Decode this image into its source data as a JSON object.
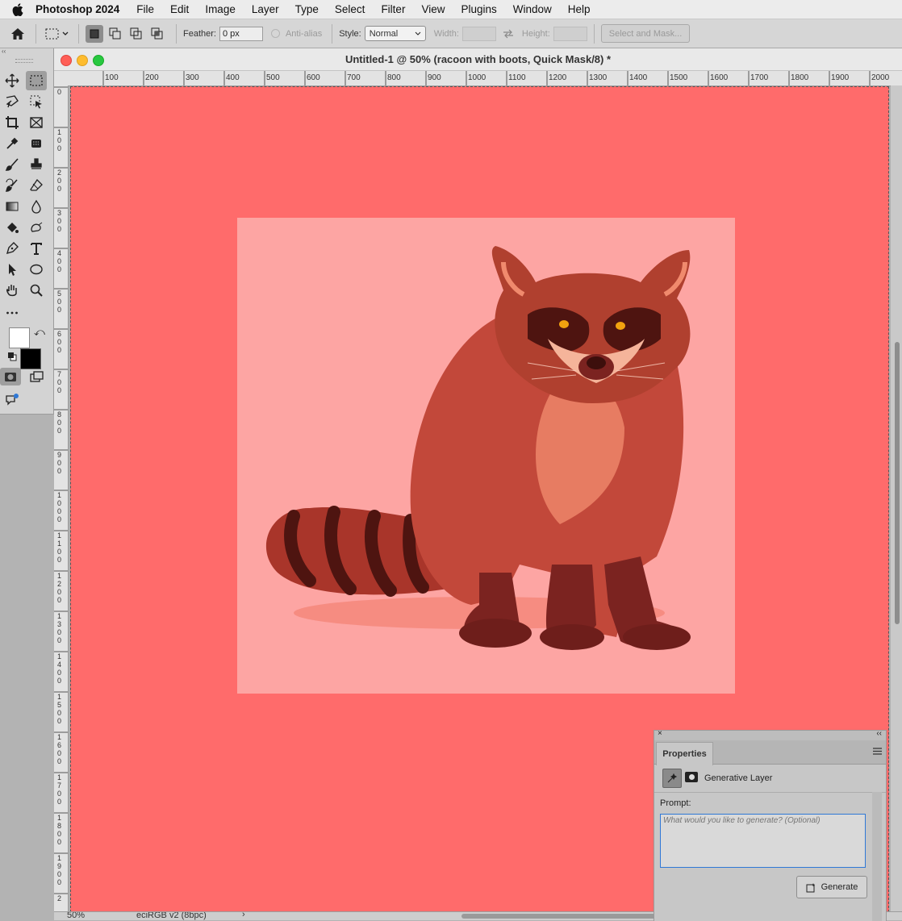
{
  "menubar": {
    "app_name": "Photoshop 2024",
    "items": [
      "File",
      "Edit",
      "Image",
      "Layer",
      "Type",
      "Select",
      "Filter",
      "View",
      "Plugins",
      "Window",
      "Help"
    ]
  },
  "options": {
    "feather_label": "Feather:",
    "feather_value": "0 px",
    "antialias_label": "Anti-alias",
    "style_label": "Style:",
    "style_value": "Normal",
    "width_label": "Width:",
    "height_label": "Height:",
    "select_mask_label": "Select and Mask..."
  },
  "document": {
    "title": "Untitled-1 @ 50% (racoon with boots, Quick Mask/8) *",
    "ruler_h": [
      "100",
      "200",
      "300",
      "400",
      "500",
      "600",
      "700",
      "800",
      "900",
      "1000",
      "1100",
      "1200",
      "1300",
      "1400",
      "1500",
      "1600",
      "1700",
      "1800",
      "1900",
      "2000"
    ],
    "ruler_v": [
      "0",
      "1\n0\n0",
      "2\n0\n0",
      "3\n0\n0",
      "4\n0\n0",
      "5\n0\n0",
      "6\n0\n0",
      "7\n0\n0",
      "8\n0\n0",
      "9\n0\n0",
      "1\n0\n0\n0",
      "1\n1\n0\n0",
      "1\n2\n0\n0",
      "1\n3\n0\n0",
      "1\n4\n0\n0",
      "1\n5\n0\n0",
      "1\n6\n0\n0",
      "1\n7\n0\n0",
      "1\n8\n0\n0",
      "1\n9\n0\n0",
      "2"
    ],
    "zoom": "50%",
    "color_profile": "eciRGB v2 (8bpc)",
    "mask_color": "#ff6b6b"
  },
  "properties": {
    "tab_label": "Properties",
    "layer_type": "Generative Layer",
    "prompt_label": "Prompt:",
    "prompt_placeholder": "What would you like to generate? (Optional)",
    "generate_label": "Generate"
  },
  "icons": {
    "tools": [
      "move-icon",
      "marquee-icon",
      "lasso-icon",
      "object-select-icon",
      "crop-icon",
      "frame-icon",
      "eyedropper-icon",
      "spot-heal-icon",
      "brush-icon",
      "stamp-icon",
      "history-brush-icon",
      "eraser-icon",
      "gradient-icon",
      "blur-icon",
      "paint-bucket-icon",
      "smudge-icon",
      "pen-icon",
      "type-icon",
      "path-select-icon",
      "ellipse-icon",
      "hand-icon",
      "zoom-icon",
      "more-tools-icon",
      "quick-mask-icon",
      "screen-mode-icon",
      "generative-icon"
    ]
  }
}
